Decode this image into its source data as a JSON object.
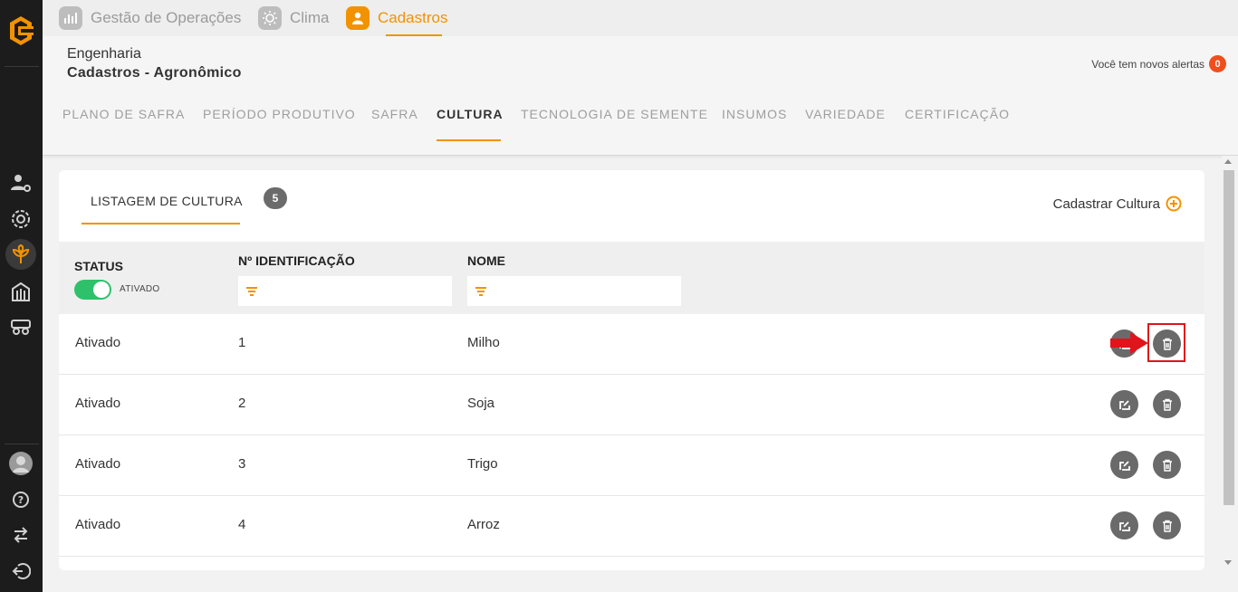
{
  "app_tabs": [
    {
      "label": "Gestão de Operações",
      "icon": "operations-chart-icon"
    },
    {
      "label": "Clima",
      "icon": "sun-icon"
    },
    {
      "label": "Cadastros",
      "icon": "user-icon"
    }
  ],
  "active_app_tab": "Cadastros",
  "breadcrumb": {
    "section": "Engenharia",
    "page": "Cadastros - Agronômico"
  },
  "alerts": {
    "label": "Você tem novos alertas",
    "count": "0"
  },
  "subtabs": [
    "PLANO DE SAFRA",
    "PERÍODO PRODUTIVO",
    "SAFRA",
    "CULTURA",
    "TECNOLOGIA DE SEMENTE",
    "INSUMOS",
    "VARIEDADE",
    "CERTIFICAÇÃO"
  ],
  "active_subtab": "CULTURA",
  "list": {
    "tab_label": "LISTAGEM DE CULTURA",
    "count": "5",
    "add_label": "Cadastrar Cultura",
    "columns": {
      "status": "STATUS",
      "id": "Nº IDENTIFICAÇÃO",
      "name": "NOME"
    },
    "status_filter": {
      "label": "ATIVADO",
      "on": true
    },
    "rows": [
      {
        "status": "Ativado",
        "id": "1",
        "name": "Milho"
      },
      {
        "status": "Ativado",
        "id": "2",
        "name": "Soja"
      },
      {
        "status": "Ativado",
        "id": "3",
        "name": "Trigo"
      },
      {
        "status": "Ativado",
        "id": "4",
        "name": "Arroz"
      }
    ]
  },
  "colors": {
    "accent": "#f39200",
    "sidebar": "#1c1c1c",
    "toggle_on": "#2fc06b",
    "alert_badge": "#f04e1c",
    "highlight": "#e0141b"
  }
}
